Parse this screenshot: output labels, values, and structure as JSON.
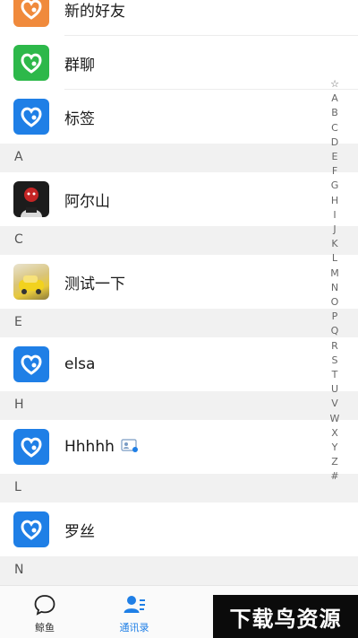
{
  "rows": [
    {
      "name": "新的好友",
      "icon": "app-logo-icon",
      "color": "#f08a3c"
    },
    {
      "name": "群聊",
      "icon": "app-logo-icon",
      "color": "#2db84a"
    },
    {
      "name": "标签",
      "icon": "app-logo-icon",
      "color": "#1f7fe6"
    }
  ],
  "sections": {
    "a": "A",
    "c": "C",
    "e": "E",
    "h": "H",
    "l": "L",
    "n": "N"
  },
  "contacts": {
    "a1": "阿尔山",
    "c1": "测试一下",
    "e1": "elsa",
    "h1": "Hhhhh",
    "l1": "罗丝"
  },
  "index_letters": [
    "☆",
    "A",
    "B",
    "C",
    "D",
    "E",
    "F",
    "G",
    "H",
    "I",
    "J",
    "K",
    "L",
    "M",
    "N",
    "O",
    "P",
    "Q",
    "R",
    "S",
    "T",
    "U",
    "V",
    "W",
    "X",
    "Y",
    "Z",
    "#"
  ],
  "tabs": {
    "chat": "鲸鱼",
    "contacts": "通讯录"
  },
  "watermark": "下载鸟资源",
  "colors": {
    "accent": "#1f7fe6",
    "section_bg": "#f1f1f1"
  }
}
